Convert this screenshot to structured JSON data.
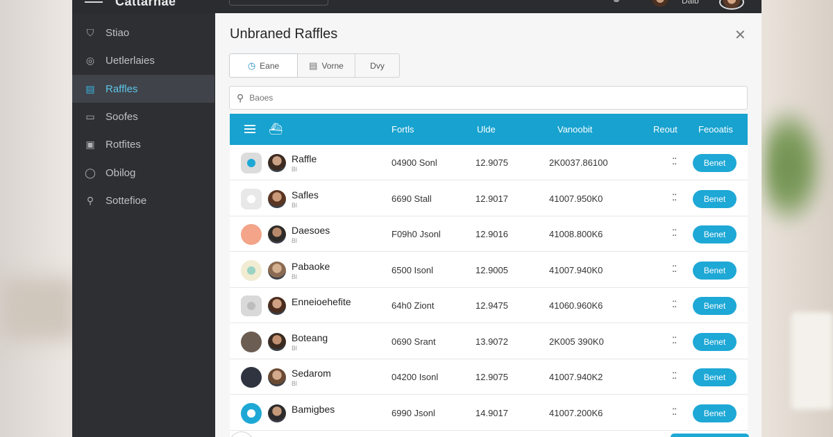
{
  "app": {
    "brand": "Cattarnae",
    "user_name": "Dalb"
  },
  "sidebar": {
    "items": [
      {
        "label": "Stiao",
        "icon": "shopping-bag-icon"
      },
      {
        "label": "Uetlerlaies",
        "icon": "check-circle-icon"
      },
      {
        "label": "Raffles",
        "icon": "ticket-icon",
        "active": true
      },
      {
        "label": "Soofes",
        "icon": "document-icon"
      },
      {
        "label": "Rotfites",
        "icon": "image-icon"
      },
      {
        "label": "Obilog",
        "icon": "circle-icon"
      },
      {
        "label": "Sottefioe",
        "icon": "search-icon"
      }
    ]
  },
  "panel": {
    "title": "Unbraned Raffles",
    "segments": [
      {
        "label": "Eane",
        "icon": "clock-icon"
      },
      {
        "label": "Vorne",
        "icon": "list-icon"
      },
      {
        "label": "Dvy",
        "icon": "edit-icon"
      }
    ],
    "search_placeholder": "Baoes",
    "columns": {
      "c1": "Fortls",
      "c2": "Ulde",
      "c3": "Vanoobit",
      "c4": "Reout",
      "c5": "Feooatis"
    },
    "rows": [
      {
        "name": "Raffle",
        "sub": "Bl",
        "c1": "04900  Sonl",
        "c2": "12.9075",
        "c3": "2K0037.86100",
        "button": "Benet",
        "chip_color": "#dcdcdc",
        "chip_dot": "#1ea8d6",
        "chip_round": false
      },
      {
        "name": "Safles",
        "sub": "Bl",
        "c1": "6690  Stall",
        "c2": "12.9017",
        "c3": "41007.950K0",
        "button": "Benet",
        "chip_color": "#e8e8e8",
        "chip_dot": "#ffffff",
        "chip_round": false
      },
      {
        "name": "Daesoes",
        "sub": "Bl",
        "c1": "F09h0  Jsonl",
        "c2": "12.9016",
        "c3": "41008.800K6",
        "button": "Benet",
        "chip_color": "#f3a489",
        "chip_dot": "#f3a489",
        "chip_round": true
      },
      {
        "name": "Pabaoke",
        "sub": "Bl",
        "c1": "6500  Isonl",
        "c2": "12.9005",
        "c3": "41007.940K0",
        "button": "Benet",
        "chip_color": "#f1ecd2",
        "chip_dot": "#9ad3c4",
        "chip_round": true
      },
      {
        "name": "Enneioehefite",
        "sub": "",
        "c1": "64h0  Ziont",
        "c2": "12.9475",
        "c3": "41060.960K6",
        "button": "Benet",
        "chip_color": "#d9d9d9",
        "chip_dot": "#bdbdbd",
        "chip_round": false
      },
      {
        "name": "Boteang",
        "sub": "Bl",
        "c1": "0690  Srant",
        "c2": "13.9072",
        "c3": "2K005 390K0",
        "button": "Benet",
        "chip_color": "#6b5d52",
        "chip_dot": "#6b5d52",
        "chip_round": true
      },
      {
        "name": "Sedarom",
        "sub": "Bl",
        "c1": "04200  Isonl",
        "c2": "12.9075",
        "c3": "41007.940K2",
        "button": "Benet",
        "chip_color": "#2f3440",
        "chip_dot": "#2f3440",
        "chip_round": true
      },
      {
        "name": "Bamigbes",
        "sub": "",
        "c1": "6990  Jsonl",
        "c2": "14.9017",
        "c3": "41007.200K6",
        "button": "Benet",
        "chip_color": "#1ea8d6",
        "chip_dot": "#ffffff",
        "chip_round": true
      }
    ]
  },
  "colors": {
    "accent": "#17a2cf",
    "sidebar_bg": "#2d2f32",
    "active_item": "#5dc3e8"
  }
}
